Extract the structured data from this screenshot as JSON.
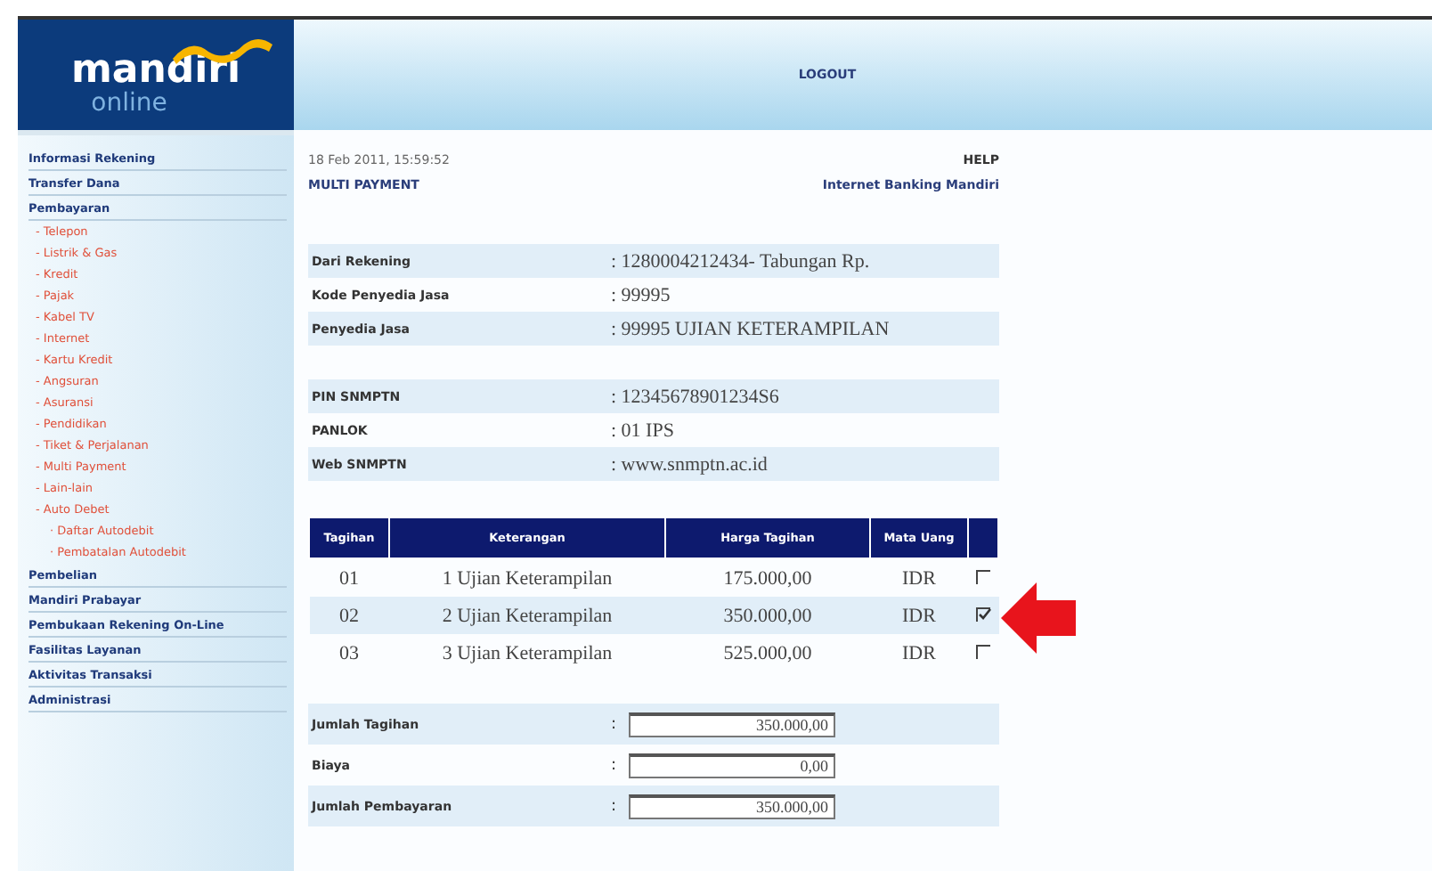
{
  "header": {
    "logo": {
      "brand": "mandiri",
      "sub": "online"
    },
    "logout": "LOGOUT"
  },
  "sidebar": {
    "items": [
      {
        "label": "Informasi Rekening",
        "kind": "section"
      },
      {
        "label": "Transfer Dana",
        "kind": "section"
      },
      {
        "label": "Pembayaran",
        "kind": "section",
        "children": [
          {
            "label": "- Telepon"
          },
          {
            "label": "- Listrik & Gas"
          },
          {
            "label": "- Kredit"
          },
          {
            "label": "- Pajak"
          },
          {
            "label": "- Kabel TV"
          },
          {
            "label": "- Internet"
          },
          {
            "label": "- Kartu Kredit"
          },
          {
            "label": "- Angsuran"
          },
          {
            "label": "- Asuransi"
          },
          {
            "label": "- Pendidikan"
          },
          {
            "label": "- Tiket & Perjalanan"
          },
          {
            "label": "- Multi Payment"
          },
          {
            "label": "- Lain-lain"
          },
          {
            "label": "- Auto Debet",
            "children": [
              {
                "label": "· Daftar Autodebit"
              },
              {
                "label": "· Pembatalan Autodebit"
              }
            ]
          }
        ]
      },
      {
        "label": "Pembelian",
        "kind": "section"
      },
      {
        "label": "Mandiri Prabayar",
        "kind": "section"
      },
      {
        "label": "Pembukaan Rekening On-Line",
        "kind": "section"
      },
      {
        "label": "Fasilitas Layanan",
        "kind": "section"
      },
      {
        "label": "Aktivitas Transaksi",
        "kind": "section"
      },
      {
        "label": "Administrasi",
        "kind": "section"
      }
    ]
  },
  "content": {
    "timestamp": "18 Feb 2011, 15:59:52",
    "help": "HELP",
    "title": "MULTI PAYMENT",
    "subtitle": "Internet Banking Mandiri",
    "details": [
      [
        {
          "label": "Dari Rekening",
          "value": ": 1280004212434- Tabungan  Rp."
        },
        {
          "label": "Kode Penyedia Jasa",
          "value": ": 99995"
        },
        {
          "label": "Penyedia Jasa",
          "value": ": 99995 UJIAN KETERAMPILAN"
        }
      ],
      [
        {
          "label": "PIN SNMPTN",
          "value": ": 12345678901234S6"
        },
        {
          "label": "PANLOK",
          "value": ": 01 IPS"
        },
        {
          "label": "Web SNMPTN",
          "value": ": www.snmptn.ac.id"
        }
      ]
    ],
    "bills": {
      "columns": [
        "Tagihan",
        "Keterangan",
        "Harga Tagihan",
        "Mata Uang"
      ],
      "rows": [
        {
          "no": "01",
          "description": "1 Ujian Keterampilan",
          "amount": "175.000,00",
          "currency": "IDR",
          "checked": false
        },
        {
          "no": "02",
          "description": "2 Ujian Keterampilan",
          "amount": "350.000,00",
          "currency": "IDR",
          "checked": true
        },
        {
          "no": "03",
          "description": "3 Ujian Keterampilan",
          "amount": "525.000,00",
          "currency": "IDR",
          "checked": false
        }
      ]
    },
    "totals": [
      {
        "label": "Jumlah Tagihan",
        "colon": ":",
        "value": "350.000,00"
      },
      {
        "label": "Biaya",
        "colon": ":",
        "value": "0,00"
      },
      {
        "label": "Jumlah Pembayaran",
        "colon": ":",
        "value": "350.000,00"
      }
    ]
  }
}
